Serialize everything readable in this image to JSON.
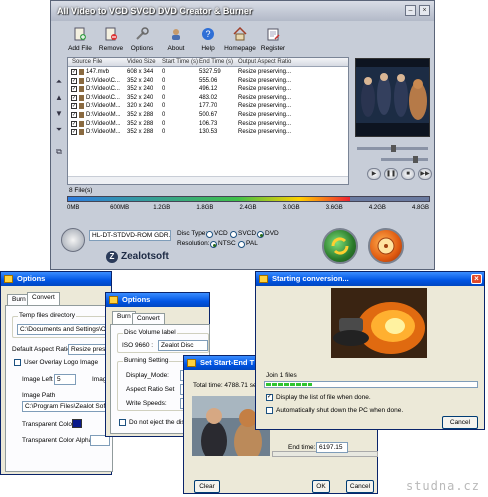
{
  "main_window": {
    "title": "All Video to VCD SVCD DVD Creator & Burner",
    "toolbar": [
      {
        "label": "Add File",
        "icon": "add-file-icon"
      },
      {
        "label": "Remove",
        "icon": "remove-icon"
      },
      {
        "label": "Options",
        "icon": "options-icon"
      },
      {
        "label": "About",
        "icon": "about-icon"
      },
      {
        "label": "Help",
        "icon": "help-icon"
      },
      {
        "label": "Homepage",
        "icon": "homepage-icon"
      },
      {
        "label": "Register",
        "icon": "register-icon"
      }
    ],
    "columns": [
      "Source File",
      "Video Size",
      "Start Time (s)",
      "End Time (s)",
      "Output Aspect Ratio"
    ],
    "rows": [
      {
        "file": "147.mvb",
        "size": "608 x 344",
        "start": "0",
        "end": "5327.59",
        "ratio": "Resize preserving..."
      },
      {
        "file": "D:\\Video\\C...",
        "size": "352 x 240",
        "start": "0",
        "end": "555.06",
        "ratio": "Resize preserving..."
      },
      {
        "file": "D:\\Video\\C...",
        "size": "352 x 240",
        "start": "0",
        "end": "496.12",
        "ratio": "Resize preserving..."
      },
      {
        "file": "D:\\Video\\C...",
        "size": "352 x 240",
        "start": "0",
        "end": "483.02",
        "ratio": "Resize preserving..."
      },
      {
        "file": "D:\\Video\\M...",
        "size": "320 x 240",
        "start": "0",
        "end": "177.70",
        "ratio": "Resize preserving..."
      },
      {
        "file": "D:\\Video\\M...",
        "size": "352 x 288",
        "start": "0",
        "end": "500.67",
        "ratio": "Resize preserving..."
      },
      {
        "file": "D:\\Video\\M...",
        "size": "352 x 288",
        "start": "0",
        "end": "106.73",
        "ratio": "Resize preserving..."
      },
      {
        "file": "D:\\Video\\M...",
        "size": "352 x 288",
        "start": "0",
        "end": "130.53",
        "ratio": "Resize preserving..."
      }
    ],
    "file_count": "8 File(s)",
    "capacity_ticks": [
      "0MB",
      "600MB",
      "1.2GB",
      "1.8GB",
      "2.4GB",
      "3.0GB",
      "3.6GB",
      "4.2GB",
      "4.8GB"
    ],
    "capacity_used_fraction": 0.78,
    "drive": "HL-DT-STDVD-ROM GDR... ",
    "disc_type_label": "Disc Type:",
    "disc_types": [
      "VCD",
      "SVCD",
      "DVD"
    ],
    "disc_type_selected": "DVD",
    "resolution_label": "Resolution:",
    "resolutions": [
      "NTSC",
      "PAL"
    ],
    "resolution_selected": "NTSC",
    "brand": "Zealotsoft"
  },
  "options_back": {
    "title": "Options",
    "tabs": [
      "Burn",
      "Convert"
    ],
    "temp_dir_label": "Temp files directory",
    "temp_dir_value": "C:\\Documents and Settings\\Owner",
    "default_aspect_label": "Default Aspect Ratio :",
    "default_aspect_value": "Resize preserv",
    "overlay_label": "User Overlay Logo Image",
    "image_left_label": "Image Left :",
    "image_left_value": "5",
    "image_label_partial": "Image",
    "image_path_label": "Image Path",
    "image_path_value": "C:\\Program Files\\Zealot Softwar",
    "transparent_color_label": "Transparent Color :",
    "transparent_alpha_label": "Transparent Color Alpha :"
  },
  "options_front": {
    "title": "Options",
    "tabs": [
      "Burn",
      "Convert"
    ],
    "volume_group": "Disc Volume label",
    "volume_prefix": "ISO 9660 :",
    "volume_value": "Zealot Disc",
    "burning_group": "Burning Setting",
    "display_mode_label": "Display_Mode:",
    "display_mode_value": "Le",
    "aspect_set_label": "Aspect Ratio Set",
    "aspect_set_value": "4",
    "write_speeds_label": "Write Speeds:",
    "write_speeds_value": "M",
    "no_eject_label": "Do not eject the disc a"
  },
  "start_end": {
    "title": "Set Start-End T",
    "total_time": "Total time: 4788.71 sec",
    "end_time_label": "End time:",
    "end_time_value": "6197.15",
    "clear_label": "Clear",
    "ok_label": "OK",
    "cancel_label": "Cancel"
  },
  "converting": {
    "title": "Starting conversion...",
    "join_label": "Join 1 files",
    "progress_fraction": 0.22,
    "display_list_label": "Display the list of file when done.",
    "display_list_checked": true,
    "shutdown_label": "Automatically shut down the PC when done.",
    "shutdown_checked": false,
    "cancel_label": "Cancel"
  },
  "watermark": "studna.cz"
}
